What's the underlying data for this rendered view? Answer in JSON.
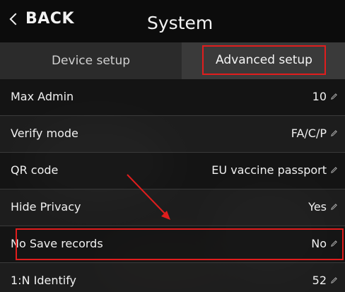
{
  "header": {
    "back_label": "BACK",
    "title": "System"
  },
  "tabs": [
    {
      "label": "Device setup",
      "active": false
    },
    {
      "label": "Advanced setup",
      "active": true
    }
  ],
  "rows": [
    {
      "label": "Max Admin",
      "value": "10",
      "icon": "pencil-icon"
    },
    {
      "label": "Verify mode",
      "value": "FA/C/P",
      "icon": "pencil-icon"
    },
    {
      "label": "QR code",
      "value": "EU vaccine passport",
      "icon": "pencil-icon"
    },
    {
      "label": "Hide Privacy",
      "value": "Yes",
      "icon": "pencil-icon"
    },
    {
      "label": "No Save records",
      "value": "No",
      "icon": "pencil-icon",
      "highlighted": true
    },
    {
      "label": "1:N Identify",
      "value": "52",
      "icon": "pencil-icon"
    }
  ],
  "annotation_color": "#e01d1d"
}
